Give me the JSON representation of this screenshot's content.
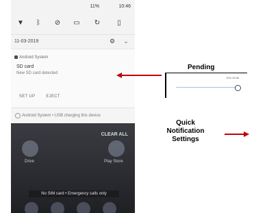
{
  "status": {
    "battery": "11%",
    "time": "10:46"
  },
  "date": "11-03-2019",
  "notification": {
    "app": "Android System",
    "title": "SD card",
    "message": "New SD card detected",
    "action_setup": "SET UP",
    "action_eject": "EJECT"
  },
  "system_message": "Android System • USB charging this device",
  "home": {
    "clear_all": "CLEAR ALL",
    "left_label": "Drive",
    "right_label": "Play Store",
    "toast": "No SIM card • Emergency calls only"
  },
  "annotations": {
    "pending": "Pending",
    "quick_settings": "Quick Notification Settings"
  },
  "inset": {
    "text": "11% 10:46"
  },
  "colors": {
    "arrow": "#c40000"
  }
}
